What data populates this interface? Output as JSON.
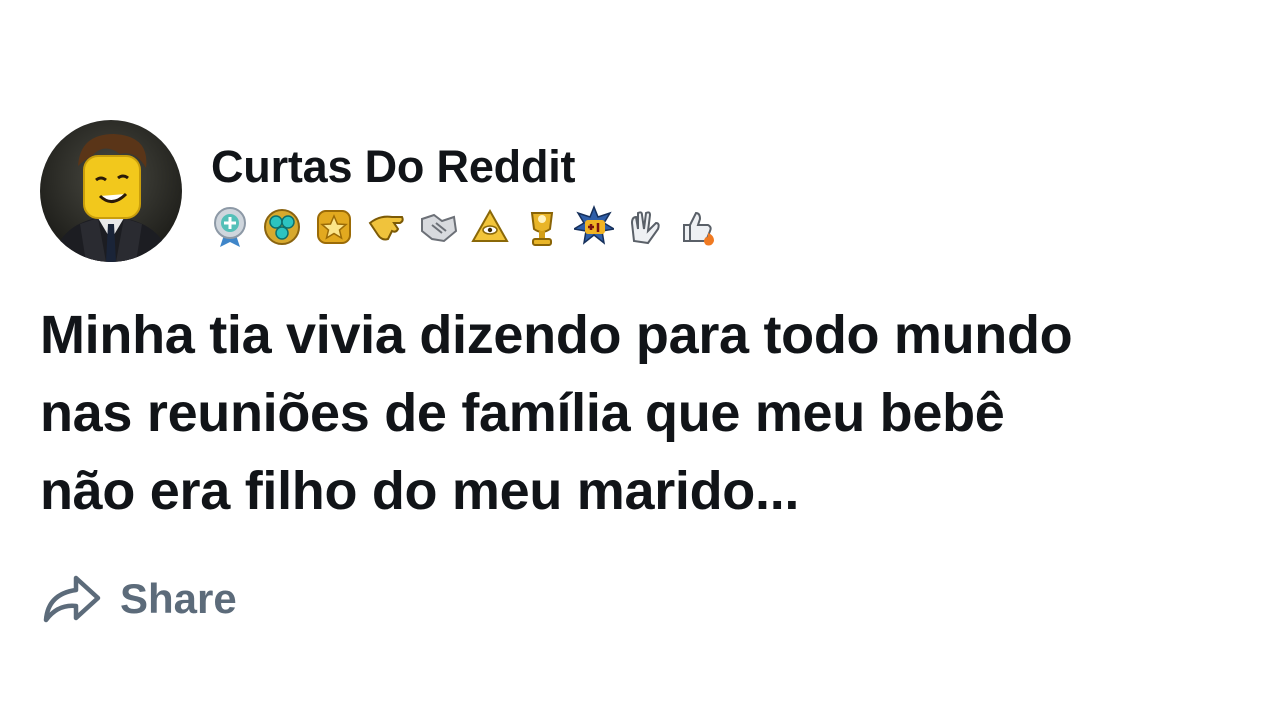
{
  "post": {
    "author": "Curtas Do Reddit",
    "title_lines": [
      "Minha tia vivia dizendo para todo mundo",
      "nas reuniões de família que meu bebê",
      "não era filho do meu marido..."
    ],
    "share_label": "Share"
  },
  "awards": [
    {
      "icon": "helpful-medal-icon"
    },
    {
      "icon": "gem-cluster-icon"
    },
    {
      "icon": "gold-star-icon"
    },
    {
      "icon": "pointing-hand-icon"
    },
    {
      "icon": "handshake-icon"
    },
    {
      "icon": "all-seeing-pyramid-icon"
    },
    {
      "icon": "gold-trophy-icon"
    },
    {
      "icon": "plus-one-icon"
    },
    {
      "icon": "clapping-hands-icon"
    },
    {
      "icon": "thumbs-up-flame-icon"
    }
  ],
  "colors": {
    "text": "#111418",
    "share": "#5c6b7a",
    "background": "#ffffff"
  }
}
